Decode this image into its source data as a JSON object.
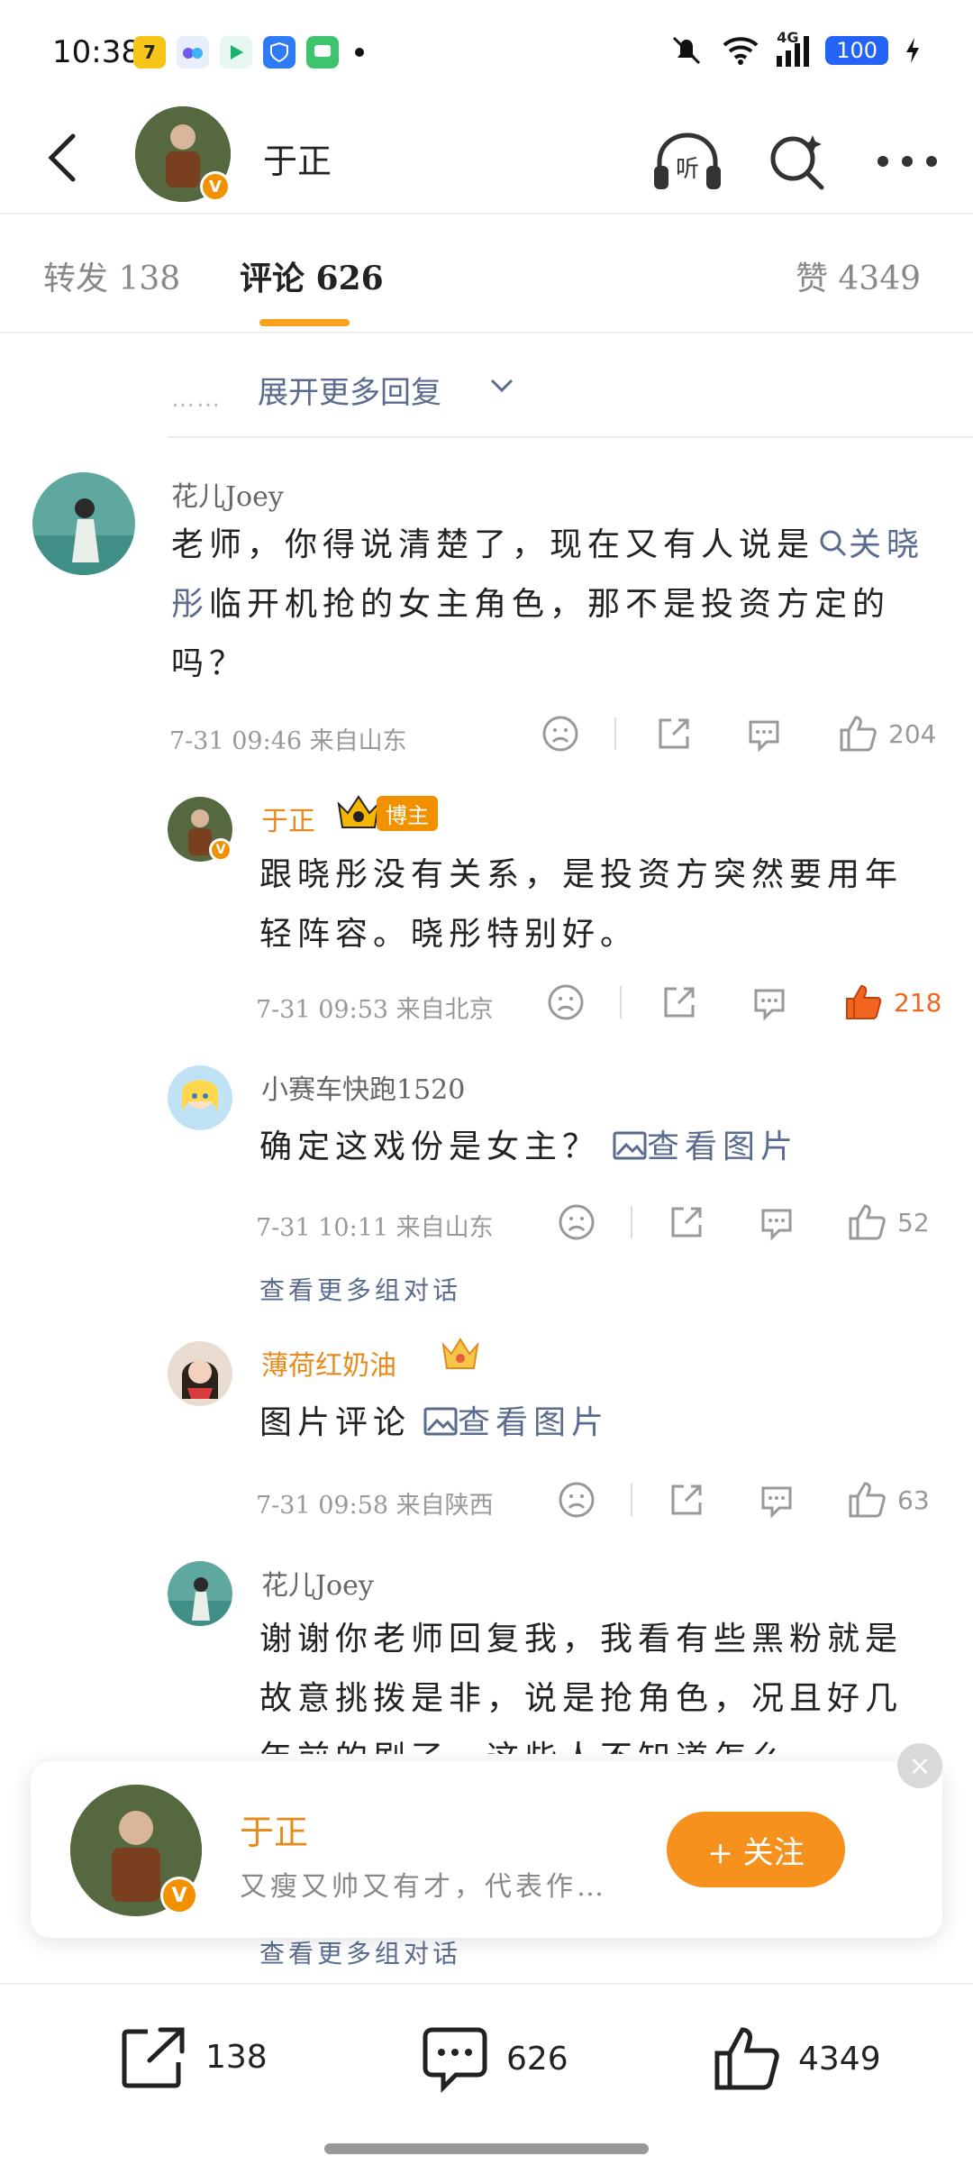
{
  "status_bar": {
    "time": "10:38",
    "network": "4G",
    "battery": "100",
    "colors": {
      "battery_bg": "#2463f6"
    }
  },
  "nav": {
    "title": "于正"
  },
  "tabs": {
    "repost": "转发 138",
    "comments": "评论 626",
    "likes": "赞 4349"
  },
  "thread": {
    "expand_more": "展开更多回复",
    "dots": "……"
  },
  "comments": [
    {
      "user": "花儿Joey",
      "text_before": "老师，你得说清楚了，现在又有人说是",
      "link_text": "关晓彤",
      "text_after": "临开机抢的女主角色，那不是投资方定的吗？",
      "meta": "7-31 09:46  来自山东",
      "likes": "204"
    }
  ],
  "replies": [
    {
      "user": "于正",
      "badge": "博主",
      "text": "跟晓彤没有关系，是投资方突然要用年轻阵容。晓彤特别好。",
      "meta": "7-31 09:53  来自北京",
      "likes": "218"
    },
    {
      "user": "小赛车快跑1520",
      "text": "确定这戏份是女主？",
      "image_link": "查看图片",
      "meta": "7-31 10:11  来自山东",
      "likes": "52",
      "more": "查看更多组对话"
    },
    {
      "user": "薄荷红奶油",
      "text": "图片评论",
      "image_link": "查看图片",
      "meta": "7-31 09:58  来自陕西",
      "likes": "63"
    },
    {
      "user": "花儿Joey",
      "text": "谢谢你老师回复我，我看有些黑粉就是故意挑拨是非，说是抢角色，况且好几年前的剧了，这些人不知道怎么",
      "more": "查看更多组对话"
    }
  ],
  "follow_card": {
    "name": "于正",
    "desc": "又瘦又帅又有才，代表作…",
    "follow_label": "+ 关注",
    "close": "×",
    "colors": {
      "button": "#f7911e",
      "name": "#e68a1c"
    }
  },
  "bottom_bar": {
    "repost_count": "138",
    "comment_count": "626",
    "like_count": "4349"
  },
  "colors": {
    "accent": "#f7a21e",
    "link": "#5a6b8f",
    "liked": "#f1661f"
  }
}
